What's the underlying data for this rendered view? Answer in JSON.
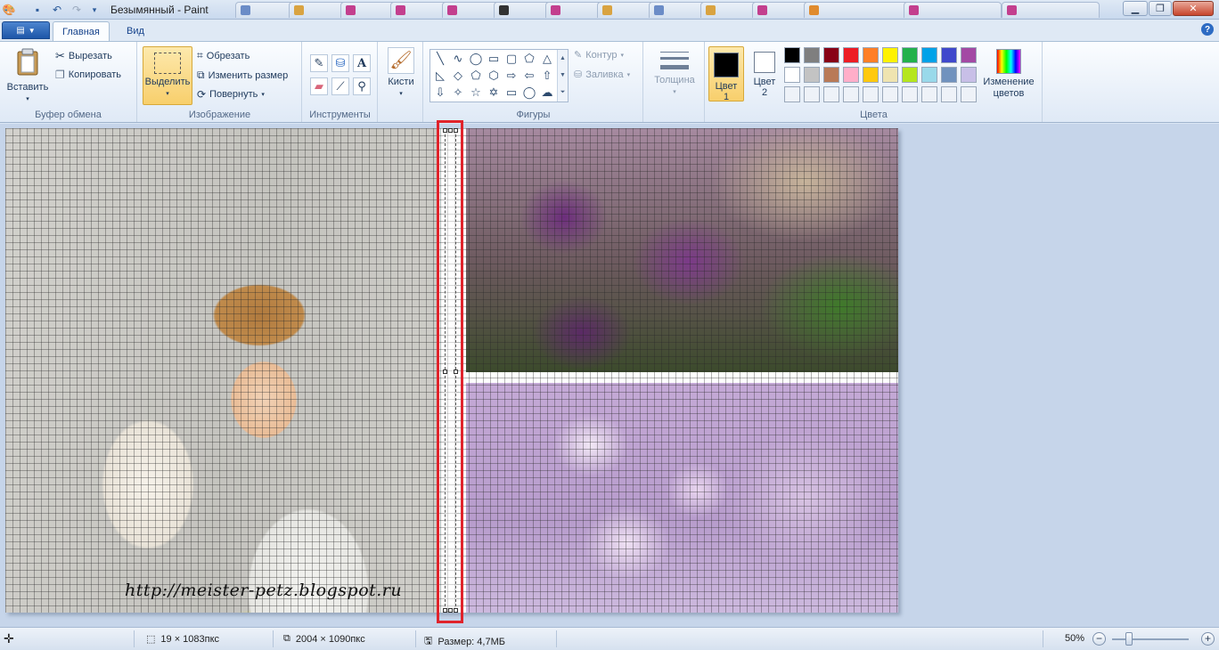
{
  "window": {
    "title": "Безымянный - Paint",
    "background_tabs": [
      "",
      "",
      "",
      "",
      "",
      "",
      "",
      "",
      "",
      "",
      "",
      ""
    ],
    "minimize_icon": "minimize-icon",
    "maximize_icon": "maximize-icon",
    "close_icon": "close-icon"
  },
  "ribbon_tabs": {
    "home": "Главная",
    "view": "Вид"
  },
  "clipboard": {
    "paste": "Вставить",
    "cut": "Вырезать",
    "copy": "Копировать",
    "label": "Буфер обмена"
  },
  "image": {
    "select": "Выделить",
    "crop": "Обрезать",
    "resize": "Изменить размер",
    "rotate": "Повернуть",
    "label": "Изображение"
  },
  "tools": {
    "label": "Инструменты"
  },
  "brushes": {
    "label": "Кисти"
  },
  "shapes": {
    "outline": "Контур",
    "fill": "Заливка",
    "label": "Фигуры"
  },
  "thickness": {
    "label": "Толщина"
  },
  "colors": {
    "color1_line1": "Цвет",
    "color1_line2": "1",
    "color2_line1": "Цвет",
    "color2_line2": "2",
    "edit_line1": "Изменение",
    "edit_line2": "цветов",
    "label": "Цвета",
    "color1": "#000000",
    "color2": "#ffffff",
    "palette_row1": [
      "#000000",
      "#7f7f7f",
      "#880015",
      "#ed1c24",
      "#ff7f27",
      "#fff200",
      "#22b14c",
      "#00a2e8",
      "#3f48cc",
      "#a349a4"
    ],
    "palette_row2": [
      "#ffffff",
      "#c3c3c3",
      "#b97a57",
      "#ffaec9",
      "#ffc90e",
      "#efe4b0",
      "#b5e61d",
      "#99d9ea",
      "#7092be",
      "#c8bfe7"
    ]
  },
  "canvas": {
    "watermark": "http://meister-petz.blogspot.ru"
  },
  "status": {
    "selection_size": "19 × 1083пкс",
    "image_size": "2004 × 1090пкс",
    "file_size": "Размер: 4,7МБ",
    "zoom": "50%",
    "zoom_level": 0.5
  }
}
